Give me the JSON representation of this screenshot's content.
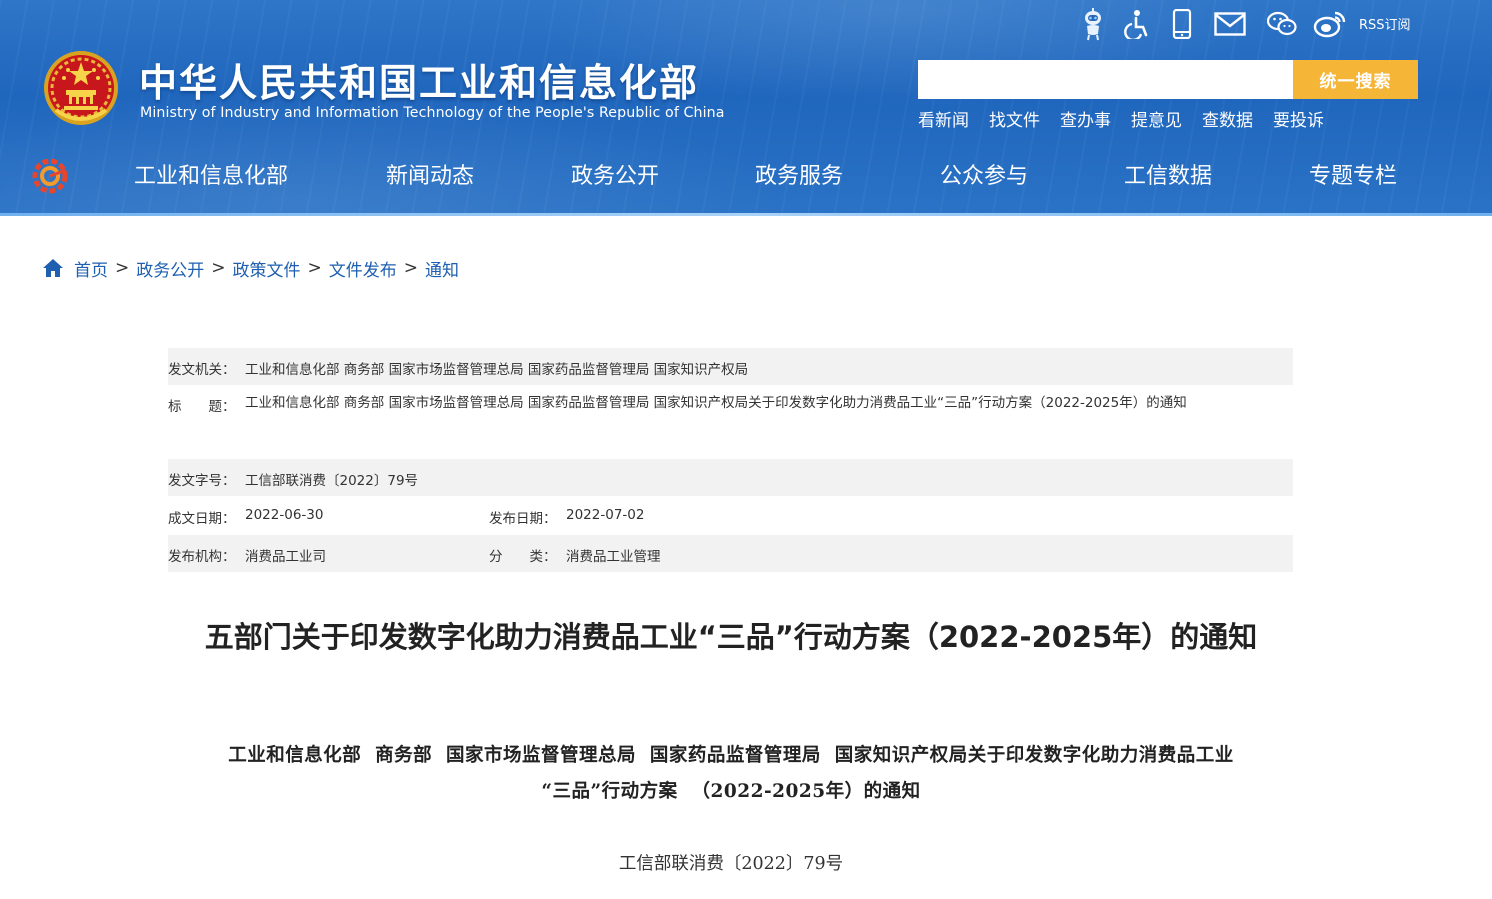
{
  "header": {
    "title": "中华人民共和国工业和信息化部",
    "subtitle": "Ministry of Industry and Information Technology of the People's Republic of China",
    "tools": [
      {
        "icon": "robot-assistant-icon"
      },
      {
        "icon": "accessibility-icon"
      },
      {
        "icon": "mobile-phone-icon"
      },
      {
        "icon": "mail-icon"
      },
      {
        "icon": "wechat-icon"
      },
      {
        "icon": "weibo-icon"
      }
    ],
    "rss_label": "RSS订阅",
    "search": {
      "placeholder": "",
      "button": "统一搜索"
    },
    "quick_links": [
      "看新闻",
      "找文件",
      "查办事",
      "提意见",
      "查数据",
      "要投诉"
    ],
    "nav": [
      "工业和信息化部",
      "新闻动态",
      "政务公开",
      "政务服务",
      "公众参与",
      "工信数据",
      "专题专栏"
    ],
    "colors": {
      "header_blue": "#2a6fc3",
      "search_button": "#f5b536"
    }
  },
  "breadcrumb": [
    "首页",
    "政务公开",
    "政策文件",
    "文件发布",
    "通知"
  ],
  "breadcrumb_sep": ">",
  "meta": {
    "issuer_label": "发文机关：",
    "issuer_value": "工业和信息化部 商务部 国家市场监督管理总局 国家药品监督管理局 国家知识产权局",
    "title_label": "标　　题：",
    "title_value": "工业和信息化部 商务部 国家市场监督管理总局 国家药品监督管理局 国家知识产权局关于印发数字化助力消费品工业“三品”行动方案（2022-2025年）的通知",
    "docno_label": "发文字号：",
    "docno_value": "工信部联消费〔2022〕79号",
    "written_label": "成文日期：",
    "written_value": "2022-06-30",
    "published_label": "发布日期：",
    "published_value": "2022-07-02",
    "agency_label": "发布机构：",
    "agency_value": "消费品工业司",
    "category_label": "分　　类：",
    "category_value": "消费品工业管理"
  },
  "article": {
    "title": "五部门关于印发数字化助力消费品工业“三品”行动方案（2022-2025年）的通知",
    "heading_line1": "工业和信息化部  商务部  国家市场监督管理总局  国家药品监督管理局  国家知识产权局关于印发数字化助力消费品工业",
    "heading_line2": "“三品”行动方案  （2022-2025年）的通知",
    "doc_number": "工信部联消费〔2022〕79号"
  }
}
